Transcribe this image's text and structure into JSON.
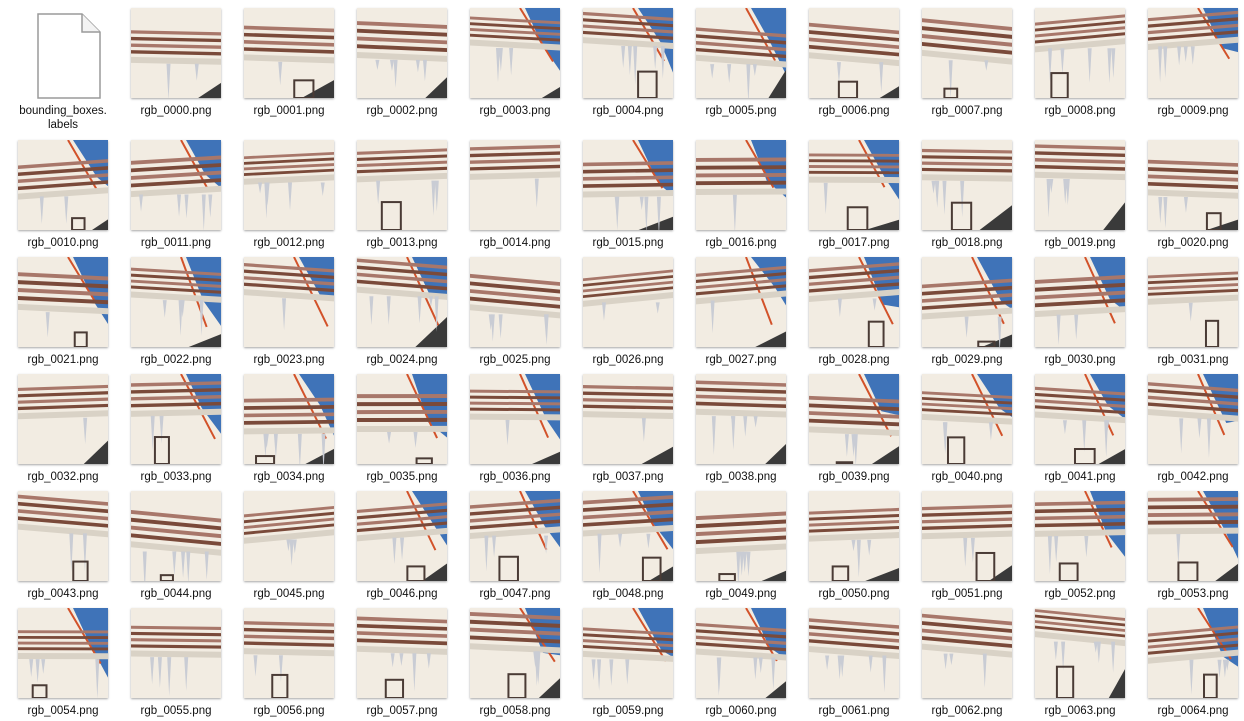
{
  "files": [
    {
      "name": "bounding_boxes.\nlabels",
      "kind": "document",
      "icon": "document-icon"
    },
    {
      "name": "rgb_0000.png",
      "kind": "image"
    },
    {
      "name": "rgb_0001.png",
      "kind": "image"
    },
    {
      "name": "rgb_0002.png",
      "kind": "image"
    },
    {
      "name": "rgb_0003.png",
      "kind": "image"
    },
    {
      "name": "rgb_0004.png",
      "kind": "image"
    },
    {
      "name": "rgb_0005.png",
      "kind": "image"
    },
    {
      "name": "rgb_0006.png",
      "kind": "image"
    },
    {
      "name": "rgb_0007.png",
      "kind": "image"
    },
    {
      "name": "rgb_0008.png",
      "kind": "image"
    },
    {
      "name": "rgb_0009.png",
      "kind": "image"
    },
    {
      "name": "rgb_0010.png",
      "kind": "image"
    },
    {
      "name": "rgb_0011.png",
      "kind": "image"
    },
    {
      "name": "rgb_0012.png",
      "kind": "image"
    },
    {
      "name": "rgb_0013.png",
      "kind": "image"
    },
    {
      "name": "rgb_0014.png",
      "kind": "image"
    },
    {
      "name": "rgb_0015.png",
      "kind": "image"
    },
    {
      "name": "rgb_0016.png",
      "kind": "image"
    },
    {
      "name": "rgb_0017.png",
      "kind": "image"
    },
    {
      "name": "rgb_0018.png",
      "kind": "image"
    },
    {
      "name": "rgb_0019.png",
      "kind": "image"
    },
    {
      "name": "rgb_0020.png",
      "kind": "image"
    },
    {
      "name": "rgb_0021.png",
      "kind": "image"
    },
    {
      "name": "rgb_0022.png",
      "kind": "image"
    },
    {
      "name": "rgb_0023.png",
      "kind": "image"
    },
    {
      "name": "rgb_0024.png",
      "kind": "image"
    },
    {
      "name": "rgb_0025.png",
      "kind": "image"
    },
    {
      "name": "rgb_0026.png",
      "kind": "image"
    },
    {
      "name": "rgb_0027.png",
      "kind": "image"
    },
    {
      "name": "rgb_0028.png",
      "kind": "image"
    },
    {
      "name": "rgb_0029.png",
      "kind": "image"
    },
    {
      "name": "rgb_0030.png",
      "kind": "image"
    },
    {
      "name": "rgb_0031.png",
      "kind": "image"
    },
    {
      "name": "rgb_0032.png",
      "kind": "image"
    },
    {
      "name": "rgb_0033.png",
      "kind": "image"
    },
    {
      "name": "rgb_0034.png",
      "kind": "image"
    },
    {
      "name": "rgb_0035.png",
      "kind": "image"
    },
    {
      "name": "rgb_0036.png",
      "kind": "image"
    },
    {
      "name": "rgb_0037.png",
      "kind": "image"
    },
    {
      "name": "rgb_0038.png",
      "kind": "image"
    },
    {
      "name": "rgb_0039.png",
      "kind": "image"
    },
    {
      "name": "rgb_0040.png",
      "kind": "image"
    },
    {
      "name": "rgb_0041.png",
      "kind": "image"
    },
    {
      "name": "rgb_0042.png",
      "kind": "image"
    },
    {
      "name": "rgb_0043.png",
      "kind": "image"
    },
    {
      "name": "rgb_0044.png",
      "kind": "image"
    },
    {
      "name": "rgb_0045.png",
      "kind": "image"
    },
    {
      "name": "rgb_0046.png",
      "kind": "image"
    },
    {
      "name": "rgb_0047.png",
      "kind": "image"
    },
    {
      "name": "rgb_0048.png",
      "kind": "image"
    },
    {
      "name": "rgb_0049.png",
      "kind": "image"
    },
    {
      "name": "rgb_0050.png",
      "kind": "image"
    },
    {
      "name": "rgb_0051.png",
      "kind": "image"
    },
    {
      "name": "rgb_0052.png",
      "kind": "image"
    },
    {
      "name": "rgb_0053.png",
      "kind": "image"
    },
    {
      "name": "rgb_0054.png",
      "kind": "image"
    },
    {
      "name": "rgb_0055.png",
      "kind": "image"
    },
    {
      "name": "rgb_0056.png",
      "kind": "image"
    },
    {
      "name": "rgb_0057.png",
      "kind": "image"
    },
    {
      "name": "rgb_0058.png",
      "kind": "image"
    },
    {
      "name": "rgb_0059.png",
      "kind": "image"
    },
    {
      "name": "rgb_0060.png",
      "kind": "image"
    },
    {
      "name": "rgb_0061.png",
      "kind": "image"
    },
    {
      "name": "rgb_0062.png",
      "kind": "image"
    },
    {
      "name": "rgb_0063.png",
      "kind": "image"
    },
    {
      "name": "rgb_0064.png",
      "kind": "image"
    }
  ],
  "colors": {
    "wall": "#f2ece2",
    "wall_shadow": "#d9d2c6",
    "railing": "#7a4a3a",
    "railing_light": "#a8776a",
    "roof_trim": "#d2522a",
    "sky": "#3f73b8",
    "ground": "#3a3a3a",
    "icicle": "#c9ccd4",
    "window": "#4a3b35"
  }
}
